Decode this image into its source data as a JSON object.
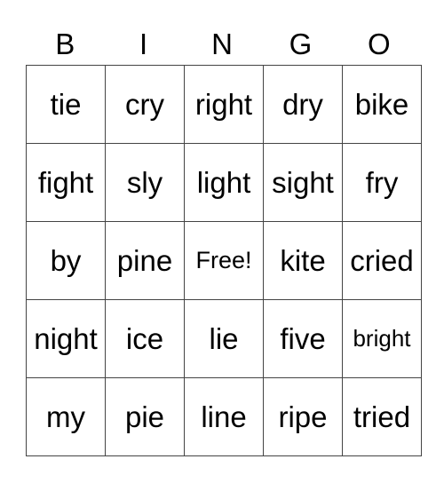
{
  "title_letters": [
    "B",
    "I",
    "N",
    "G",
    "O"
  ],
  "rows": [
    [
      "tie",
      "cry",
      "right",
      "dry",
      "bike"
    ],
    [
      "fight",
      "sly",
      "light",
      "sight",
      "fry"
    ],
    [
      "by",
      "pine",
      "Free!",
      "kite",
      "cried"
    ],
    [
      "night",
      "ice",
      "lie",
      "five",
      "bright"
    ],
    [
      "my",
      "pie",
      "line",
      "ripe",
      "tried"
    ]
  ]
}
